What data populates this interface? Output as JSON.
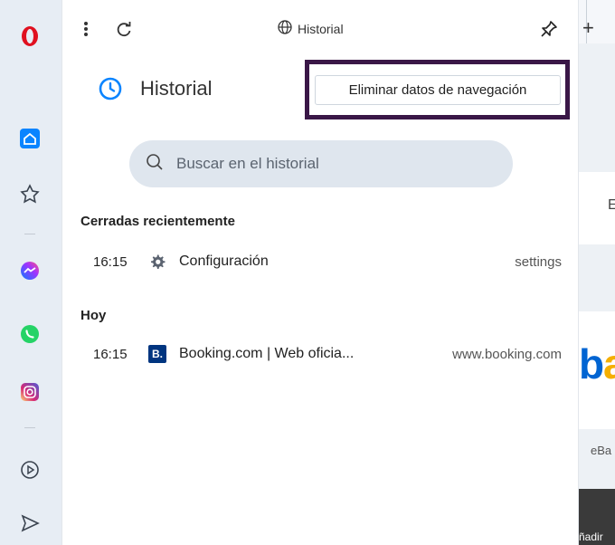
{
  "browser": {
    "tab_title": "Historial",
    "new_tab_glyph": "+"
  },
  "sidebar": {
    "items": [
      {
        "icon": "opera-logo"
      },
      {
        "icon": "home-icon"
      },
      {
        "icon": "bookmark-icon"
      },
      {
        "icon": "messenger-icon"
      },
      {
        "icon": "whatsapp-icon"
      },
      {
        "icon": "instagram-icon"
      },
      {
        "icon": "player-icon"
      },
      {
        "icon": "send-icon"
      }
    ]
  },
  "history": {
    "title": "Historial",
    "clear_button": "Eliminar datos de navegación",
    "search_placeholder": "Buscar en el historial",
    "sections": [
      {
        "heading": "Cerradas recientemente",
        "rows": [
          {
            "time": "16:15",
            "title": "Configuración",
            "host": "settings",
            "favicon": "gear-icon"
          }
        ]
      },
      {
        "heading": "Hoy",
        "rows": [
          {
            "time": "16:15",
            "title": "Booking.com | Web oficia...",
            "host": "www.booking.com",
            "favicon": "booking-favicon",
            "favicon_letter": "B."
          }
        ]
      }
    ]
  },
  "background_page": {
    "fragments": [
      "E",
      "eBa",
      "ñadir"
    ]
  },
  "colors": {
    "opera_red": "#e0101f",
    "highlight_frame": "#3a1747",
    "sidebar_bg": "#e7edf4",
    "active_blue": "#0a84ff",
    "booking_blue": "#003580"
  }
}
